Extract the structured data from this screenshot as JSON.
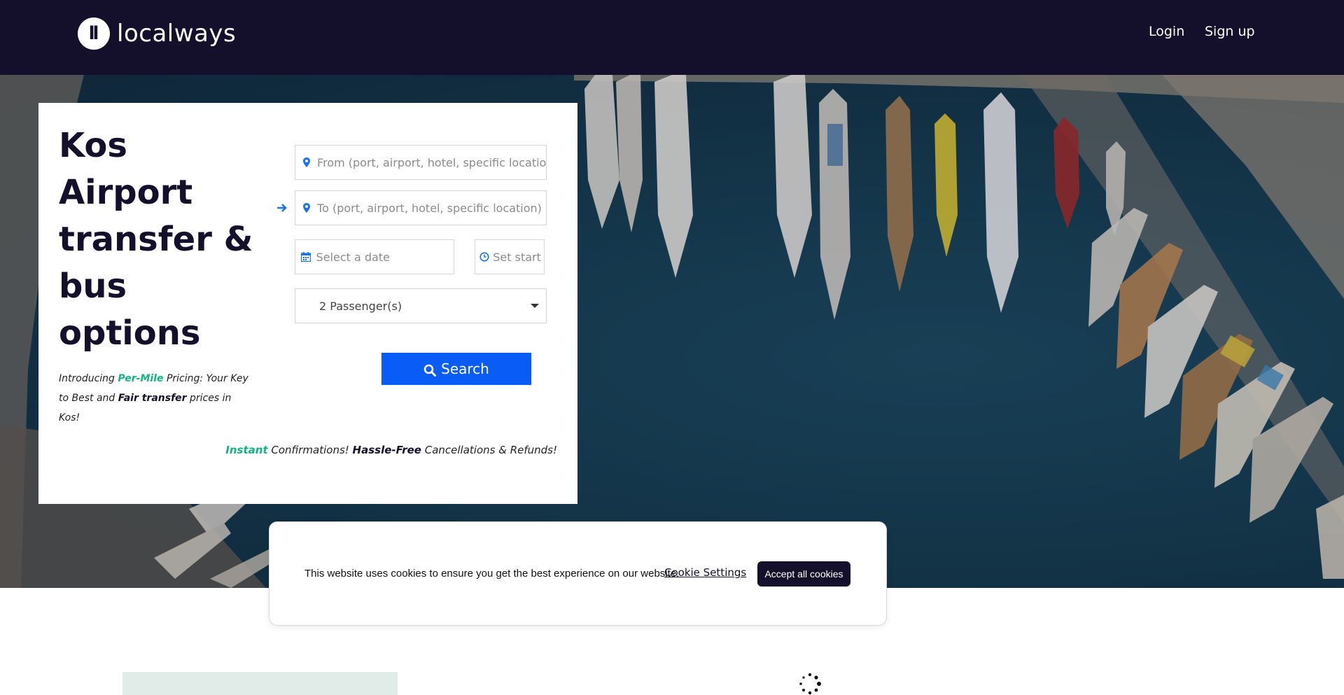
{
  "header": {
    "logo_mark": "ll",
    "logo_text": "localways",
    "nav": {
      "login": "Login",
      "signup": "Sign up"
    }
  },
  "hero": {
    "title": "Kos Airport transfer & bus options",
    "promo": {
      "prefix": "Introducing ",
      "highlight": "Per-Mile",
      "middle": " Pricing: Your Key to Best and ",
      "bold": "Fair transfer",
      "suffix": " prices in Kos!"
    }
  },
  "form": {
    "from_placeholder": "From (port, airport, hotel, specific location)",
    "to_placeholder": "To (port, airport, hotel, specific location)",
    "date_placeholder": "Select a date",
    "time_placeholder": "Set start time",
    "passengers": "2 Passenger(s)",
    "search_label": "Search"
  },
  "tagline": {
    "green": "Instant",
    "part1": " Confirmations! ",
    "bold": "Hassle-Free",
    "part2": " Cancellations & Refunds!"
  },
  "cookie": {
    "message": "This website uses cookies to ensure you get the best experience on our website.",
    "settings_label": "Cookie Settings",
    "accept_label": "Accept all cookies"
  },
  "icons": {
    "from": "map-pin-icon",
    "to": "map-pin-icon",
    "swap": "arrow-right-icon",
    "date": "calendar-icon",
    "time": "clock-icon",
    "dropdown": "caret-down-icon",
    "search": "search-icon",
    "loading": "spinner-icon"
  },
  "colors": {
    "brand_dark": "#140f2a",
    "accent_blue": "#0a5cf7",
    "accent_green": "#13b383"
  }
}
